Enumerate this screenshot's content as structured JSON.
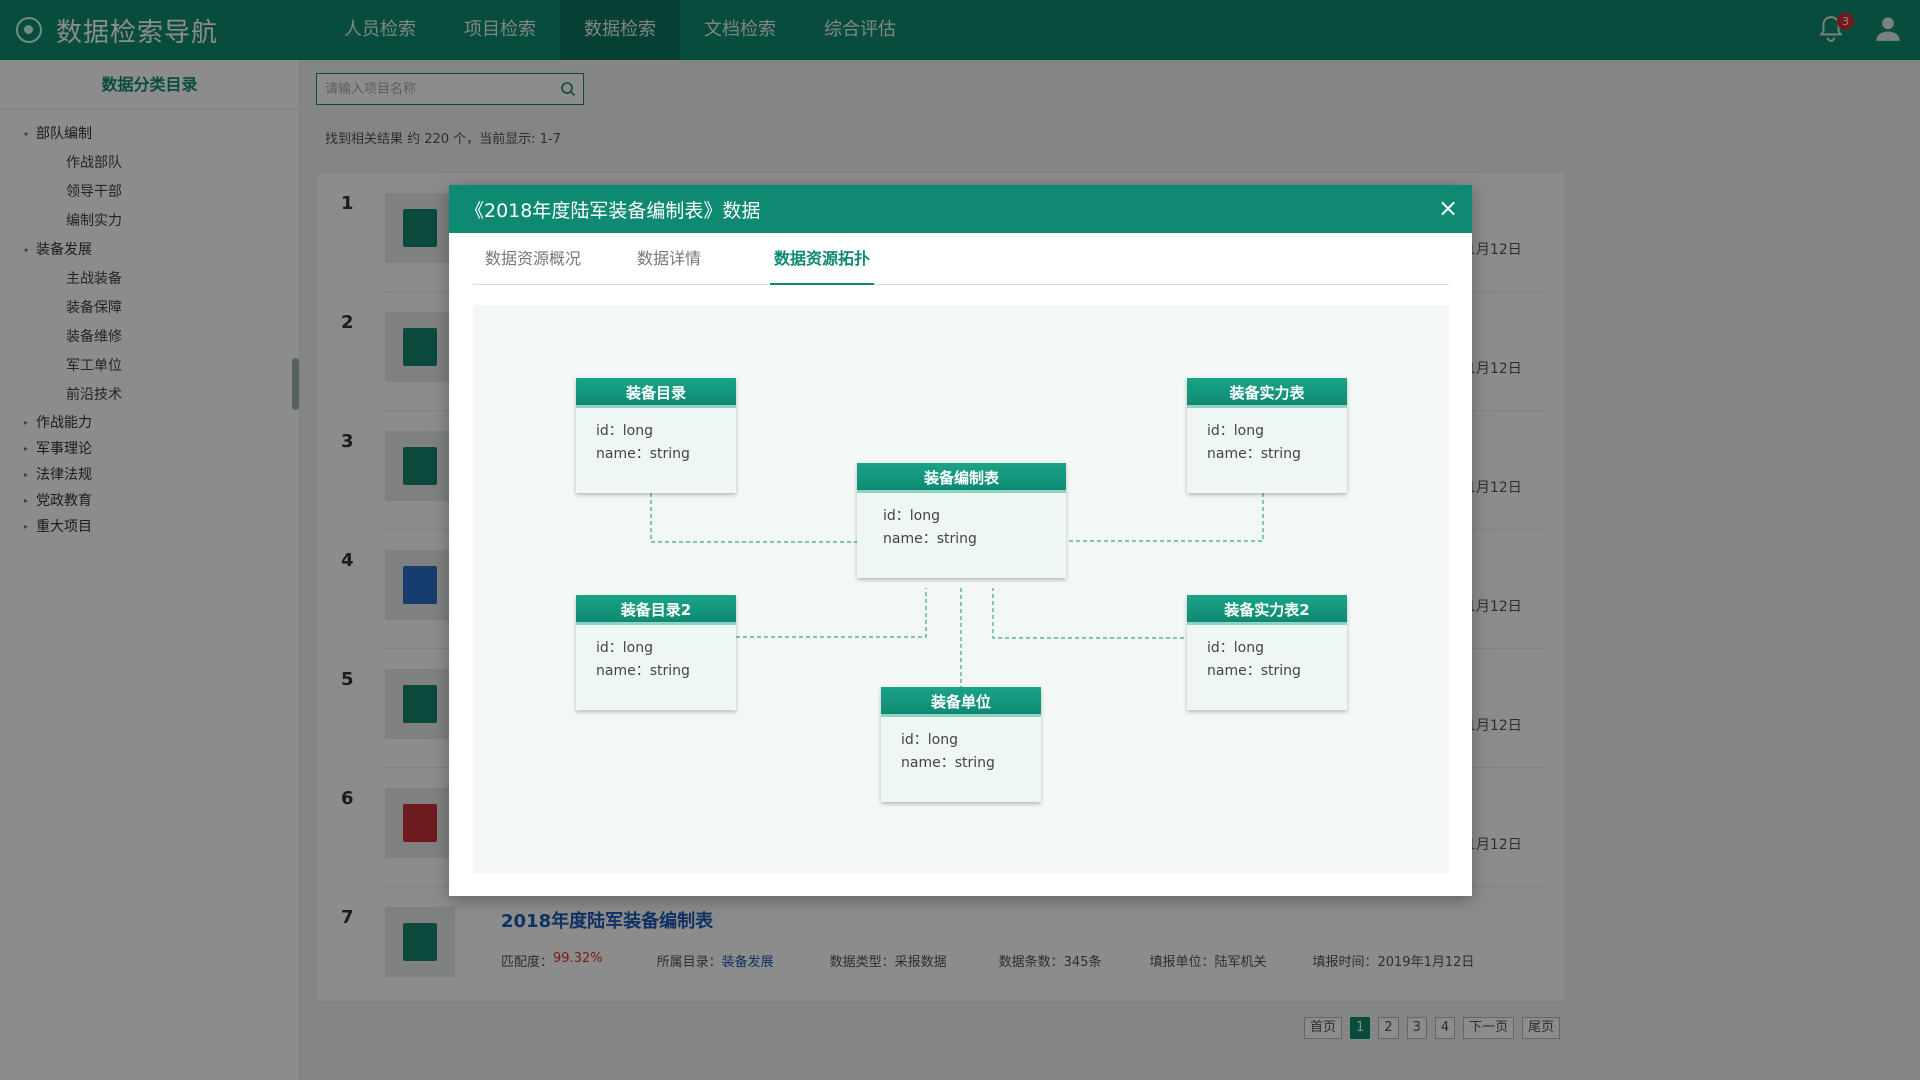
{
  "app": {
    "title": "数据检索导航"
  },
  "nav": {
    "items": [
      "人员检索",
      "项目检索",
      "数据检索",
      "文档检索",
      "综合评估"
    ],
    "active_index": 2
  },
  "notifications": {
    "count": "3"
  },
  "sidebar": {
    "title": "数据分类目录",
    "groups": [
      {
        "label": "部队编制",
        "expanded": true,
        "children": [
          "作战部队",
          "领导干部",
          "编制实力"
        ]
      },
      {
        "label": "装备发展",
        "expanded": true,
        "children": [
          "主战装备",
          "装备保障",
          "装备维修",
          "军工单位",
          "前沿技术"
        ]
      },
      {
        "label": "作战能力",
        "expanded": false,
        "children": []
      },
      {
        "label": "军事理论",
        "expanded": false,
        "children": []
      },
      {
        "label": "法律法规",
        "expanded": false,
        "children": []
      },
      {
        "label": "党政教育",
        "expanded": false,
        "children": []
      },
      {
        "label": "重大项目",
        "expanded": false,
        "children": []
      }
    ]
  },
  "search": {
    "placeholder": "请输入项目名称",
    "value": ""
  },
  "result_info": "找到相关结果 约 220 个，当前显示: 1-7",
  "results": [
    {
      "num": "1",
      "icon": "spreadsheet-icon",
      "date": "1月12日"
    },
    {
      "num": "2",
      "icon": "spreadsheet-icon",
      "date": "1月12日"
    },
    {
      "num": "3",
      "icon": "spreadsheet-icon",
      "date": "1月12日"
    },
    {
      "num": "4",
      "icon": "document-icon",
      "date": "1月12日"
    },
    {
      "num": "5",
      "icon": "spreadsheet-icon",
      "date": "1月12日"
    },
    {
      "num": "6",
      "icon": "pdf-icon",
      "date": "1月12日"
    },
    {
      "num": "7",
      "icon": "spreadsheet-icon",
      "title": "2018年度陆军装备编制表",
      "match_label": "匹配度：",
      "match_value": "99.32%",
      "catalog_label": "所属目录：",
      "catalog_value": "装备发展",
      "type_text": "数据类型：采报数据",
      "count_text": "数据条数：345条",
      "unit_text": "填报单位：陆军机关",
      "time_text": "填报时间：2019年1月12日"
    }
  ],
  "pagination": {
    "first": "首页",
    "pages": [
      "1",
      "2",
      "3",
      "4"
    ],
    "active": "1",
    "next": "下一页",
    "last": "尾页"
  },
  "modal": {
    "title": "《2018年度陆军装备编制表》数据",
    "close_symbol": "×",
    "tabs": [
      "数据资源概况",
      "数据详情",
      "数据资源拓扑"
    ],
    "active_tab": 2,
    "entities": [
      {
        "name": "装备目录",
        "fields": [
          "id：long",
          "name：string"
        ]
      },
      {
        "name": "装备实力表",
        "fields": [
          "id：long",
          "name：string"
        ]
      },
      {
        "name": "装备编制表",
        "fields": [
          "id：long",
          "name：string"
        ]
      },
      {
        "name": "装备目录2",
        "fields": [
          "id：long",
          "name：string"
        ]
      },
      {
        "name": "装备实力表2",
        "fields": [
          "id：long",
          "name：string"
        ]
      },
      {
        "name": "装备单位",
        "fields": [
          "id：long",
          "name：string"
        ]
      }
    ]
  },
  "colors": {
    "brand": "#0f8a72",
    "link": "#1d5bb5",
    "match": "#dd3333"
  }
}
